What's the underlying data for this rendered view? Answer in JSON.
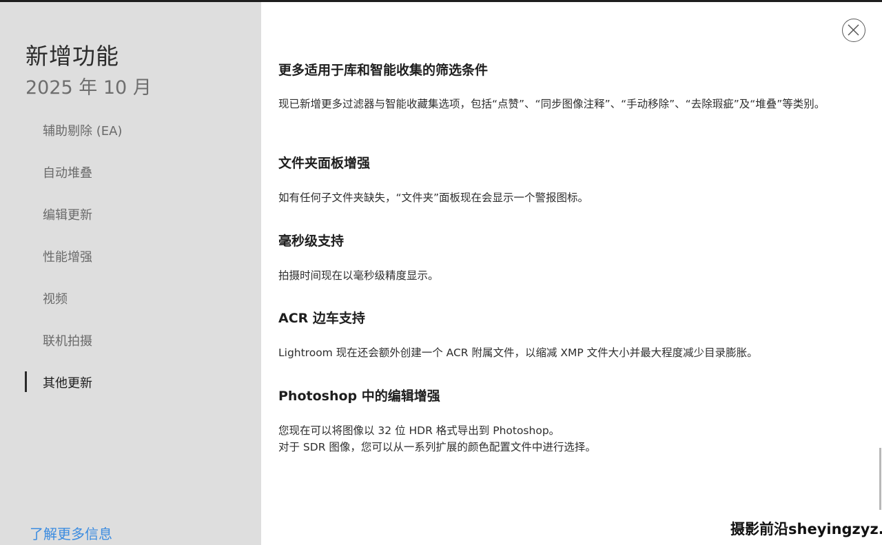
{
  "sidebar": {
    "title": "新增功能",
    "date": "2025 年 10 月",
    "items": [
      {
        "label": "辅助剔除 (EA)"
      },
      {
        "label": "自动堆叠"
      },
      {
        "label": "编辑更新"
      },
      {
        "label": "性能增强"
      },
      {
        "label": "视频"
      },
      {
        "label": "联机拍摄"
      },
      {
        "label": "其他更新"
      }
    ],
    "active_index": 6,
    "learn_more": "了解更多信息"
  },
  "close_icon": "close-circle-icon",
  "sections": [
    {
      "title": "更多适用于库和智能收集的筛选条件",
      "body": "现已新增更多过滤器与智能收藏集选项，包括“点赞”、“同步图像注释”、“手动移除”、“去除瑕疵”及“堆叠”等类别。"
    },
    {
      "title": "文件夹面板增强",
      "body": "如有任何子文件夹缺失，“文件夹”面板现在会显示一个警报图标。"
    },
    {
      "title": "毫秒级支持",
      "body": "拍摄时间现在以毫秒级精度显示。"
    },
    {
      "title": "ACR 边车支持",
      "body": "Lightroom 现在还会额外创建一个 ACR 附属文件，以缩减 XMP 文件大小并最大程度减少目录膨胀。"
    },
    {
      "title": "Photoshop 中的编辑增强",
      "body": "您现在可以将图像以 32 位 HDR 格式导出到 Photoshop。\n对于 SDR 图像，您可以从一系列扩展的颜色配置文件中进行选择。"
    }
  ],
  "watermark": "摄影前沿sheyingzyz.com",
  "colors": {
    "sidebar_bg": "#dedede",
    "link": "#3c8ce0",
    "text": "#1e1e1e"
  }
}
